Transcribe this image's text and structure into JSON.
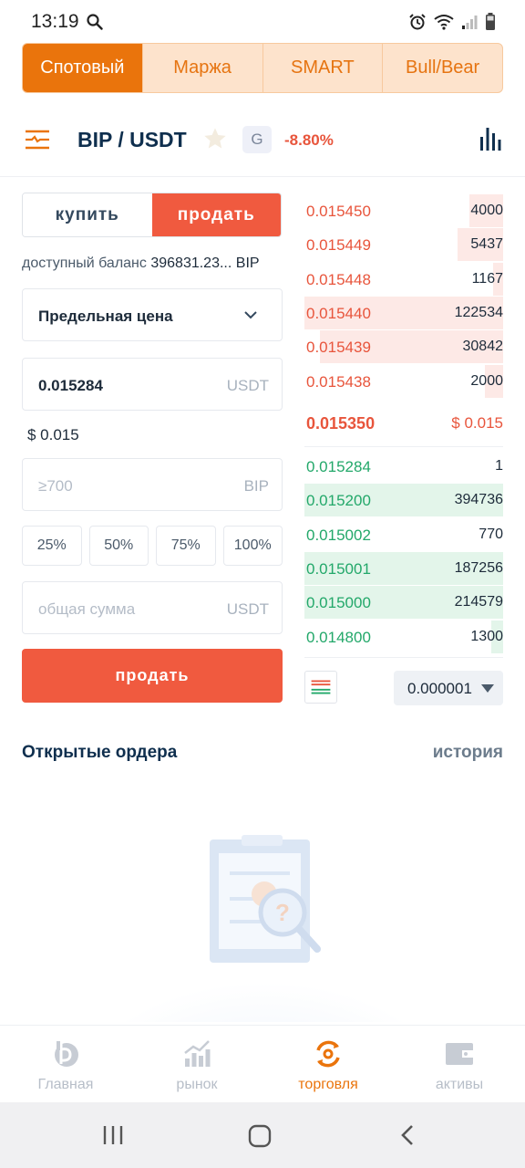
{
  "status_bar": {
    "time": "13:19"
  },
  "mode_tabs": [
    {
      "label": "Спотовый",
      "active": true
    },
    {
      "label": "Маржа",
      "active": false
    },
    {
      "label": "SMART",
      "active": false
    },
    {
      "label": "Bull/Bear",
      "active": false
    }
  ],
  "header": {
    "pair": "BIP / USDT",
    "badge": "G",
    "change": "-8.80%"
  },
  "form": {
    "buy_label": "купить",
    "sell_label": "продать",
    "balance_label": "доступный баланс",
    "balance_value": "396831.23...",
    "balance_unit": "BIP",
    "order_type": "Предельная цена",
    "price_value": "0.015284",
    "price_unit": "USDT",
    "usd_price": "$ 0.015",
    "amount_placeholder": "≥700",
    "amount_unit": "BIP",
    "percents": [
      "25%",
      "50%",
      "75%",
      "100%"
    ],
    "total_placeholder": "общая сумма",
    "total_unit": "USDT",
    "submit_label": "продать"
  },
  "order_book": {
    "asks": [
      {
        "price": "0.015450",
        "qty": "4000",
        "depth": 0.17
      },
      {
        "price": "0.015449",
        "qty": "5437",
        "depth": 0.23
      },
      {
        "price": "0.015448",
        "qty": "1167",
        "depth": 0.05
      },
      {
        "price": "0.015440",
        "qty": "122534",
        "depth": 1.0
      },
      {
        "price": "0.015439",
        "qty": "30842",
        "depth": 0.92
      },
      {
        "price": "0.015438",
        "qty": "2000",
        "depth": 0.09
      }
    ],
    "last_price": "0.015350",
    "last_price_usd": "$ 0.015",
    "bids": [
      {
        "price": "0.015284",
        "qty": "1",
        "depth": 0.0
      },
      {
        "price": "0.015200",
        "qty": "394736",
        "depth": 1.0
      },
      {
        "price": "0.015002",
        "qty": "770",
        "depth": 0.0
      },
      {
        "price": "0.015001",
        "qty": "187256",
        "depth": 1.0
      },
      {
        "price": "0.015000",
        "qty": "214579",
        "depth": 1.0
      },
      {
        "price": "0.014800",
        "qty": "1300",
        "depth": 0.06
      }
    ],
    "precision": "0.000001"
  },
  "orders": {
    "title": "Открытые ордера",
    "history_label": "история"
  },
  "bottom_nav": [
    {
      "label": "Главная",
      "icon": "home-coin-icon",
      "active": false
    },
    {
      "label": "рынок",
      "icon": "market-chart-icon",
      "active": false
    },
    {
      "label": "торговля",
      "icon": "trade-icon",
      "active": true
    },
    {
      "label": "активы",
      "icon": "wallet-icon",
      "active": false
    }
  ],
  "colors": {
    "accent": "#ea740c",
    "sell": "#f05a3f",
    "buy": "#23a86a",
    "navy": "#0f2f4e"
  }
}
